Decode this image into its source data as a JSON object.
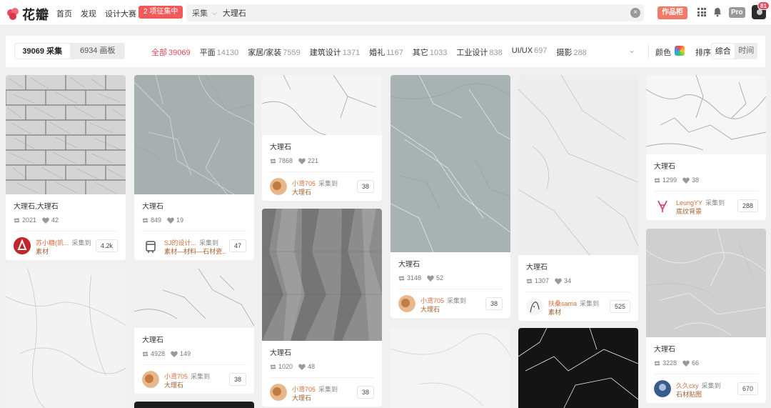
{
  "header": {
    "logo_text": "花瓣",
    "nav": [
      "首页",
      "发现",
      "设计大赛"
    ],
    "badge": "2 项征集中",
    "search": {
      "scope": "采集",
      "query": "大理石"
    },
    "works_button": "作品柜",
    "pro_label": "Pro",
    "notification_count": "81"
  },
  "filters": {
    "tab_pins": "39069 采集",
    "tab_boards": "6934 画板",
    "categories": [
      {
        "name": "全部",
        "count": "39069"
      },
      {
        "name": "平面",
        "count": "14130"
      },
      {
        "name": "家居/家装",
        "count": "7559"
      },
      {
        "name": "建筑设计",
        "count": "1371"
      },
      {
        "name": "婚礼",
        "count": "1167"
      },
      {
        "name": "其它",
        "count": "1033"
      },
      {
        "name": "工业设计",
        "count": "838"
      },
      {
        "name": "UI/UX",
        "count": "697"
      },
      {
        "name": "摄影",
        "count": "288"
      }
    ],
    "color_label": "颜色",
    "sort_label": "排序",
    "sort_options": [
      "综合",
      "时间"
    ]
  },
  "cards": [
    {
      "title": "大理石,大理石",
      "repins": "2021",
      "likes": "42",
      "user": "苏小糖(凯...",
      "via": "采集到",
      "board": "素材",
      "count": "4.2k"
    },
    {
      "title": "大理石",
      "repins": "849",
      "likes": "19",
      "user": "SJ的设计...",
      "via": "采集到",
      "board": "素材—材料—石材瓷...",
      "count": "47"
    },
    {
      "title": "大理石",
      "repins": "7868",
      "likes": "221",
      "user": "小鸢705",
      "via": "采集到",
      "board": "大理石",
      "count": "38"
    },
    {
      "title": "大理石",
      "repins": "4928",
      "likes": "149",
      "user": "小鸢705",
      "via": "采集到",
      "board": "大理石",
      "count": "38"
    },
    {
      "title": "大理石",
      "repins": "1020",
      "likes": "48",
      "user": "小鸢705",
      "via": "采集到",
      "board": "大理石",
      "count": "38"
    },
    {
      "title": "大理石",
      "repins": "3148",
      "likes": "52",
      "user": "小鸢705",
      "via": "采集到",
      "board": "大理石",
      "count": "38"
    },
    {
      "title": "大理石",
      "repins": "1307",
      "likes": "34",
      "user": "扶桑sama",
      "via": "采集到",
      "board": "素材",
      "count": "525"
    },
    {
      "title": "大理石",
      "repins": "1299",
      "likes": "38",
      "user": "LeungYY",
      "via": "采集到",
      "board": "底纹背景",
      "count": "288"
    },
    {
      "title": "大理石",
      "repins": "3228",
      "likes": "66",
      "user": "久久cxy",
      "via": "采集到",
      "board": "石材贴图",
      "count": "670"
    }
  ]
}
